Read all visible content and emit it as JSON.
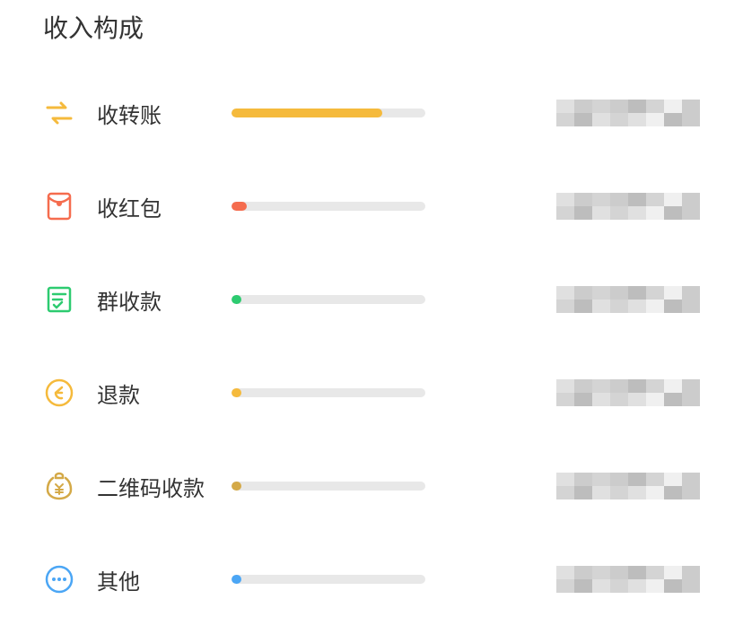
{
  "title": "收入构成",
  "items": [
    {
      "label": "收转账",
      "icon": "transfer-icon",
      "color": "#F5BA3C",
      "fillPercent": 78
    },
    {
      "label": "收红包",
      "icon": "red-envelope-icon",
      "color": "#F56C4E",
      "fillPercent": 8
    },
    {
      "label": "群收款",
      "icon": "group-collect-icon",
      "color": "#2DCB70",
      "fillPercent": 5
    },
    {
      "label": "退款",
      "icon": "refund-icon",
      "color": "#F5BA3C",
      "fillPercent": 5
    },
    {
      "label": "二维码收款",
      "icon": "qr-collect-icon",
      "color": "#D4A947",
      "fillPercent": 5
    },
    {
      "label": "其他",
      "icon": "more-icon",
      "color": "#4BA6F5",
      "fillPercent": 5
    }
  ]
}
